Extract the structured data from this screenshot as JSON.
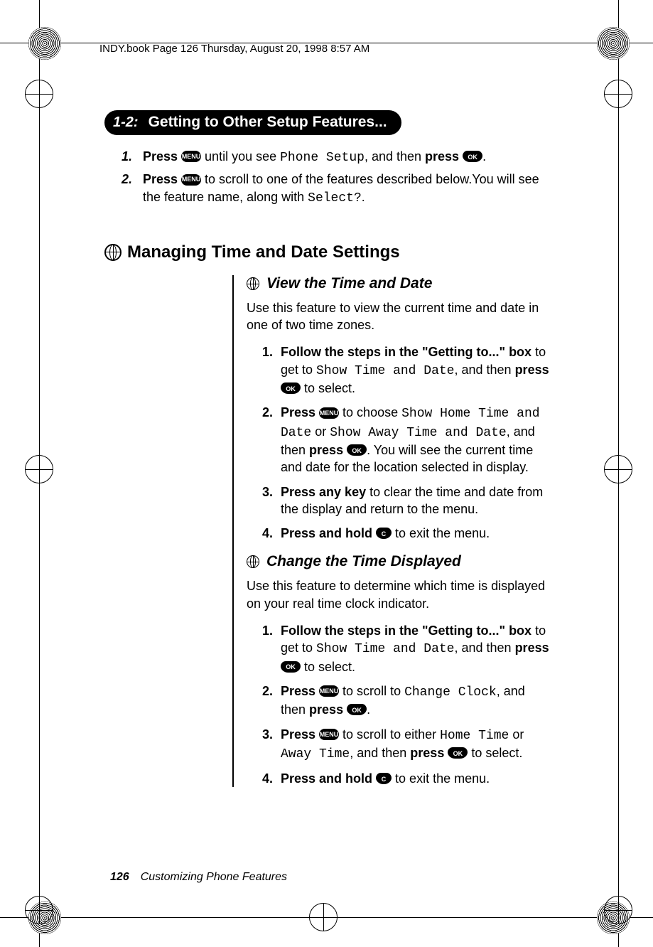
{
  "header": "INDY.book  Page 126  Thursday, August 20, 1998  8:57 AM",
  "keys": {
    "menu": "MENU",
    "ok": "OK",
    "c": "C"
  },
  "pill": {
    "num": "1-2:",
    "title": "Getting to Other Setup Features..."
  },
  "box_steps": [
    {
      "n": "1.",
      "pre": "Press ",
      "key1": "menu",
      "mid1": " until you see ",
      "lcd1": "Phone Setup",
      "mid2": ", and then ",
      "bold2": "press ",
      "key2": "ok",
      "post": "."
    },
    {
      "n": "2.",
      "pre": "Press ",
      "key1": "menu",
      "mid1": " to scroll to one of the features described below.You will see the feature name, along with ",
      "lcd1": "Select?",
      "post": "."
    }
  ],
  "section_title": "Managing Time and Date Settings",
  "sub1": {
    "title": "View the Time and Date",
    "para": "Use this feature to view the current time and date in one of two time zones.",
    "steps": {
      "s1": {
        "n": "1.",
        "b1": "Follow the steps in the \"Getting to...\" box",
        "t1": " to get to ",
        "lcd1": "Show Time and Date",
        "t2": ", and then ",
        "b2": "press ",
        "key2": "ok",
        "t3": " to select."
      },
      "s2": {
        "n": "2.",
        "b1": "Press ",
        "key1": "menu",
        "t1": " to choose ",
        "lcd1": "Show Home Time and Date",
        "t2": " or ",
        "lcd2": "Show Away Time and Date",
        "t3": ", and then ",
        "b2": "press ",
        "key2": "ok",
        "t4": ". You will see the current time and date for the location selected in display."
      },
      "s3": {
        "n": "3.",
        "b1": "Press any key",
        "t1": " to clear the time and date from the display and return to the menu."
      },
      "s4": {
        "n": "4.",
        "b1": "Press and hold ",
        "key1": "c",
        "t1": " to exit the menu."
      }
    }
  },
  "sub2": {
    "title": "Change the Time Displayed",
    "para": "Use this feature to determine which time is displayed on your real time clock indicator.",
    "steps": {
      "s1": {
        "n": "1.",
        "b1": "Follow the steps in the \"Getting to...\" box",
        "t1": " to get to ",
        "lcd1": "Show Time and Date",
        "t2": ", and then ",
        "b2": "press ",
        "key2": "ok",
        "t3": " to select."
      },
      "s2": {
        "n": "2.",
        "b1": "Press ",
        "key1": "menu",
        "t1": " to scroll to ",
        "lcd1": "Change Clock",
        "t2": ", and then ",
        "b2": "press ",
        "key2": "ok",
        "t3": "."
      },
      "s3": {
        "n": "3.",
        "b1": "Press ",
        "key1": "menu",
        "t1": " to scroll to either ",
        "lcd1": "Home Time",
        "t2": " or ",
        "lcd2": "Away Time",
        "t3": ", and then ",
        "b2": "press ",
        "key2": "ok",
        "t4": " to select."
      },
      "s4": {
        "n": "4.",
        "b1": "Press and hold ",
        "key1": "c",
        "t1": " to exit the menu."
      }
    }
  },
  "footer": {
    "page": "126",
    "chapter": "Customizing Phone Features"
  }
}
